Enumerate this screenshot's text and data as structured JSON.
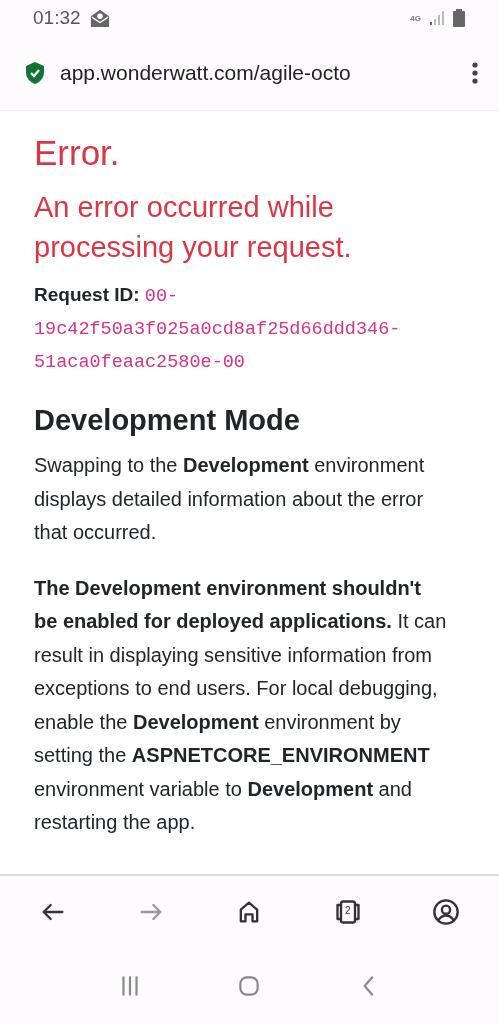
{
  "status_bar": {
    "time": "01:32",
    "network": "4G"
  },
  "address_bar": {
    "url": "app.wonderwatt.com/agile-octo",
    "secure": true
  },
  "page": {
    "title": "Error.",
    "subtitle": "An error occurred while processing your request.",
    "request_id_label": "Request ID:",
    "request_id": "00-19c42f50a3f025a0cd8af25d66ddd346-51aca0feaac2580e-00",
    "section_title": "Development Mode",
    "paragraphs": [
      "Swapping to the **Development** environment displays detailed information about the error that occurred.",
      "**The Development environment shouldn't be enabled for deployed applications.** It can result in displaying sensitive information from exceptions to end users. For local debugging, enable the **Development** environment by setting the **ASPNETCORE_ENVIRONMENT** environment variable to **Development** and restarting the app."
    ]
  },
  "toolbar": [
    {
      "kind": "back",
      "disabled": false
    },
    {
      "kind": "forward",
      "disabled": true
    },
    {
      "kind": "home",
      "disabled": false
    },
    {
      "kind": "tabs",
      "disabled": false,
      "count": "2"
    },
    {
      "kind": "account",
      "disabled": false
    }
  ],
  "system_nav": [
    {
      "kind": "recents"
    },
    {
      "kind": "home"
    },
    {
      "kind": "back"
    }
  ]
}
